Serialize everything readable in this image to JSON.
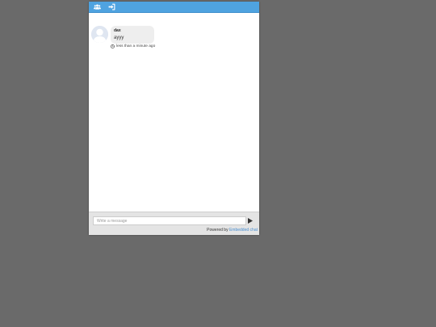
{
  "toolbar": {
    "users_icon": "users-icon",
    "logout_icon": "sign-out-icon",
    "bar_color": "#4fa3e0"
  },
  "messages": [
    {
      "author": "dax",
      "text": "ayyy",
      "time": "less than a minute ago",
      "avatar_icon": "default-user-avatar"
    }
  ],
  "composer": {
    "placeholder": "Write a message",
    "send_icon": "play-triangle-icon"
  },
  "footer": {
    "powered_by": "Powered by",
    "link_text": "Embedded chat",
    "link_color": "#4a8fd0"
  }
}
